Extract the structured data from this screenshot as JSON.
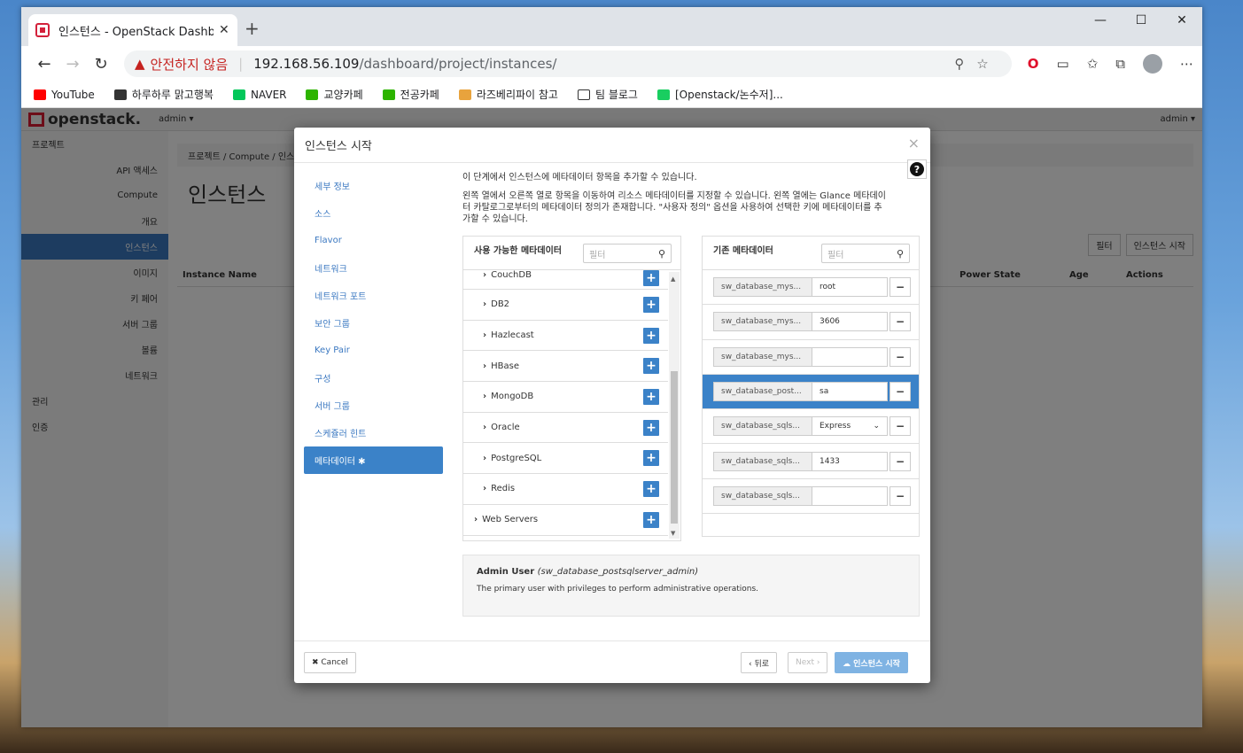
{
  "browser": {
    "tab_title": "인스턴스 - OpenStack Dashboard",
    "tab_close": "✕",
    "new_tab": "+",
    "window_controls": [
      "—",
      "☐",
      "✕"
    ],
    "back": "←",
    "forward": "→",
    "reload": "↻",
    "security_warning": "안전하지 않음",
    "url_host": "192.168.56.109",
    "url_path": "/dashboard/project/instances/",
    "bookmarks": [
      "YouTube",
      "하루하루 맑고행복",
      "NAVER",
      "교양카페",
      "전공카페",
      "라즈베리파이 참고",
      "팀 블로그",
      "[Openstack/논수저]..."
    ]
  },
  "openstack": {
    "logo": "openstack.",
    "project_menu": "admin ▾",
    "user_menu": "admin ▾",
    "sidebar": [
      "프로젝트",
      "API 액세스",
      "Compute",
      "개요",
      "인스턴스",
      "이미지",
      "키 페어",
      "서버 그룹",
      "볼륨",
      "네트워크",
      "관리",
      "인증"
    ],
    "breadcrumb": "프로젝트 / Compute / 인스턴스",
    "page_title": "인스턴스",
    "filter_button": "필터",
    "launch_button": "인스턴스 시작",
    "columns": [
      "Instance Name",
      "Power State",
      "Age",
      "Actions"
    ]
  },
  "modal": {
    "title": "인스턴스 시작",
    "close": "×",
    "help": "?",
    "steps": [
      "세부 정보",
      "소스",
      "Flavor",
      "네트워크",
      "네트워크 포트",
      "보안 그룹",
      "Key Pair",
      "구성",
      "서버 그룹",
      "스케쥴러 힌트",
      "메타데이터 ✱"
    ],
    "intro": "이 단계에서 인스턴스에 메타데이터 항목을 추가할 수 있습니다.",
    "description": "왼쪽 열에서 오른쪽 열로 항목을 이동하여 리소스 메타데이터를 지정할 수 있습니다. 왼쪽 열에는 Glance 메타데이터 카탈로그로부터의 메타데이터 정의가 존재합니다. \"사용자 정의\" 옵션을 사용하여 선택한 키에 메타데이터를 추가할 수 있습니다.",
    "available": {
      "title": "사용 가능한 메타데이터",
      "filter_placeholder": "필터",
      "items": [
        "CouchDB",
        "DB2",
        "Hazlecast",
        "HBase",
        "MongoDB",
        "Oracle",
        "PostgreSQL",
        "Redis",
        "Web Servers"
      ]
    },
    "existing": {
      "title": "기존 메타데이터",
      "filter_placeholder": "필터",
      "rows": [
        {
          "key": "sw_database_mys...",
          "value": "root"
        },
        {
          "key": "sw_database_mys...",
          "value": "3606"
        },
        {
          "key": "sw_database_mys...",
          "value": ""
        },
        {
          "key": "sw_database_post...",
          "value": "sa"
        },
        {
          "key": "sw_database_sqls...",
          "value": "Express"
        },
        {
          "key": "sw_database_sqls...",
          "value": "1433"
        },
        {
          "key": "sw_database_sqls...",
          "value": ""
        }
      ]
    },
    "info_title": "Admin User",
    "info_key": "(sw_database_postsqlserver_admin)",
    "info_text": "The primary user with privileges to perform administrative operations.",
    "cancel": "✖ Cancel",
    "back": "‹ 뒤로",
    "next": "Next ›",
    "launch": "☁ 인스턴스 시작"
  }
}
